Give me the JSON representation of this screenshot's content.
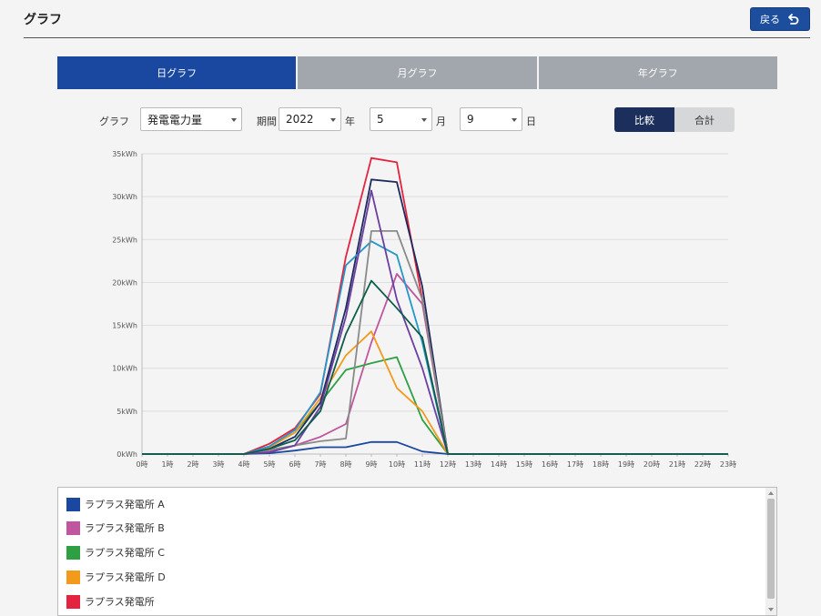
{
  "header": {
    "title": "グラフ",
    "back_label": "戻る"
  },
  "tabs": [
    {
      "label": "日グラフ",
      "active": true
    },
    {
      "label": "月グラフ",
      "active": false
    },
    {
      "label": "年グラフ",
      "active": false
    }
  ],
  "controls": {
    "graph_label": "グラフ",
    "graph_select": "発電電力量",
    "period_label": "期間",
    "year_select": "2022",
    "year_unit": "年",
    "month_select": "5",
    "month_unit": "月",
    "day_select": "9",
    "day_unit": "日",
    "mode_compare": "比較",
    "mode_total": "合計",
    "mode_active": "比較"
  },
  "chart_data": {
    "type": "line",
    "x": [
      "0時",
      "1時",
      "2時",
      "3時",
      "4時",
      "5時",
      "6時",
      "7時",
      "8時",
      "9時",
      "10時",
      "11時",
      "12時",
      "13時",
      "14時",
      "15時",
      "16時",
      "17時",
      "18時",
      "19時",
      "20時",
      "21時",
      "22時",
      "23時"
    ],
    "y_ticks": [
      "0kWh",
      "5kWh",
      "10kWh",
      "15kWh",
      "20kWh",
      "25kWh",
      "30kWh",
      "35kWh"
    ],
    "ylim": [
      0,
      35
    ],
    "grid": true,
    "series": [
      {
        "name": "ラプラス発電所 A",
        "color": "#1a48a0",
        "values": [
          0,
          0,
          0,
          0,
          0,
          0.1,
          0.4,
          0.8,
          0.8,
          1.4,
          1.4,
          0.3,
          0,
          0,
          0,
          0,
          0,
          0,
          0,
          0,
          0,
          0,
          0,
          0
        ]
      },
      {
        "name": "ラプラス発電所 B",
        "color": "#c0569e",
        "values": [
          0,
          0,
          0,
          0,
          0,
          0.3,
          1.0,
          2.0,
          3.5,
          13.0,
          21.0,
          17.5,
          0,
          0,
          0,
          0,
          0,
          0,
          0,
          0,
          0,
          0,
          0,
          0
        ]
      },
      {
        "name": "ラプラス発電所 C",
        "color": "#2ea043",
        "values": [
          0,
          0,
          0,
          0,
          0,
          0.8,
          2.5,
          6.0,
          9.8,
          10.6,
          11.3,
          4.0,
          0,
          0,
          0,
          0,
          0,
          0,
          0,
          0,
          0,
          0,
          0,
          0
        ]
      },
      {
        "name": "ラプラス発電所 D",
        "color": "#f39a1c",
        "values": [
          0,
          0,
          0,
          0,
          0,
          0.8,
          2.5,
          6.5,
          11.5,
          14.3,
          7.7,
          5.0,
          0,
          0,
          0,
          0,
          0,
          0,
          0,
          0,
          0,
          0,
          0,
          0
        ]
      },
      {
        "name": "ラプラス発電所",
        "color": "#e3233f",
        "values": [
          0,
          0,
          0,
          0,
          0,
          1.2,
          3.0,
          7.0,
          23.0,
          34.5,
          34.0,
          18.0,
          0,
          0,
          0,
          0,
          0,
          0,
          0,
          0,
          0,
          0,
          0,
          0
        ]
      },
      {
        "color": "#1f2a5c",
        "values": [
          0,
          0,
          0,
          0,
          0,
          0.6,
          2.0,
          6.0,
          17.0,
          32.0,
          31.7,
          19.5,
          0,
          0,
          0,
          0,
          0,
          0,
          0,
          0,
          0,
          0,
          0,
          0
        ]
      },
      {
        "color": "#2596c8",
        "values": [
          0,
          0,
          0,
          0,
          0,
          0.9,
          2.8,
          7.2,
          22.0,
          24.8,
          23.2,
          13.0,
          0,
          0,
          0,
          0,
          0,
          0,
          0,
          0,
          0,
          0,
          0,
          0
        ]
      },
      {
        "color": "#8a8a8a",
        "values": [
          0,
          0,
          0,
          0,
          0,
          0.5,
          1.0,
          1.5,
          1.8,
          26.0,
          26.0,
          18.0,
          0,
          0,
          0,
          0,
          0,
          0,
          0,
          0,
          0,
          0,
          0,
          0
        ]
      },
      {
        "color": "#6a3fa0",
        "values": [
          0,
          0,
          0,
          0,
          0,
          0.2,
          1.0,
          5.5,
          16.0,
          30.7,
          18.0,
          10.0,
          0,
          0,
          0,
          0,
          0,
          0,
          0,
          0,
          0,
          0,
          0,
          0
        ]
      },
      {
        "color": "#0d5c4a",
        "values": [
          0,
          0,
          0,
          0,
          0,
          0.6,
          1.6,
          5.0,
          14.0,
          20.2,
          17.0,
          13.6,
          0,
          0,
          0,
          0,
          0,
          0,
          0,
          0,
          0,
          0,
          0,
          0
        ]
      }
    ]
  },
  "legend": [
    {
      "label": "ラプラス発電所 A",
      "color": "#1a48a0"
    },
    {
      "label": "ラプラス発電所 B",
      "color": "#c0569e"
    },
    {
      "label": "ラプラス発電所 C",
      "color": "#2ea043"
    },
    {
      "label": "ラプラス発電所 D",
      "color": "#f39a1c"
    },
    {
      "label": "ラプラス発電所",
      "color": "#e3233f"
    }
  ]
}
